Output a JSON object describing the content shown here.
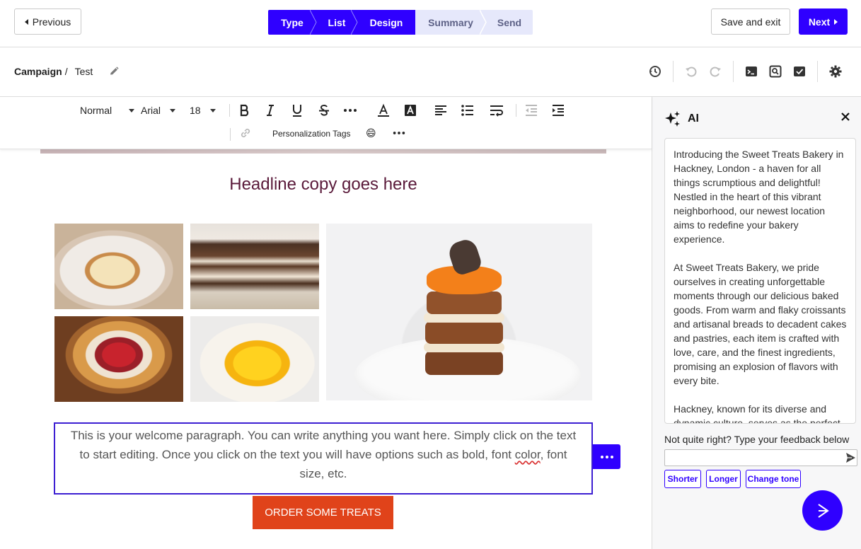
{
  "nav": {
    "previous_label": "Previous",
    "save_exit_label": "Save and exit",
    "next_label": "Next",
    "steps": [
      {
        "label": "Type",
        "active": true
      },
      {
        "label": "List",
        "active": true
      },
      {
        "label": "Design",
        "active": true
      },
      {
        "label": "Summary",
        "active": false
      },
      {
        "label": "Send",
        "active": false
      }
    ]
  },
  "breadcrumb": {
    "root": "Campaign",
    "separator": "/",
    "current": "Test"
  },
  "toolbar": {
    "block_style": "Normal",
    "font": "Arial",
    "size": "18",
    "personalization_label": "Personalization Tags",
    "emoji": "😄"
  },
  "email": {
    "headline": "Headline copy goes here",
    "welcome_before": "This is your welcome paragraph. You can write anything you want here. Simply click on the text to start editing. Once you click on the text you will have options such as bold, font ",
    "welcome_misspelled": "color",
    "welcome_after": ", font size, etc.",
    "cta_label": "ORDER SOME TREATS"
  },
  "ai": {
    "title": "AI",
    "paragraphs": [
      "Introducing the Sweet Treats Bakery in Hackney, London - a haven for all things scrumptious and delightful! Nestled in the heart of this vibrant neighborhood, our newest location aims to redefine your bakery experience.",
      "At Sweet Treats Bakery, we pride ourselves in creating unforgettable moments through our delicious baked goods. From warm and flaky croissants and artisanal breads to decadent cakes and pastries, each item is crafted with love, care, and the finest ingredients, promising an explosion of flavors with every bite.",
      "Hackney, known for its diverse and dynamic culture, serves as the perfect"
    ],
    "feedback_label": "Not quite right? Type your feedback below",
    "feedback_value": "",
    "chips": [
      "Shorter",
      "Longer",
      "Change tone"
    ]
  },
  "colors": {
    "primary": "#2f00ff",
    "cta": "#e0431a",
    "headline": "#5a1a3a"
  }
}
